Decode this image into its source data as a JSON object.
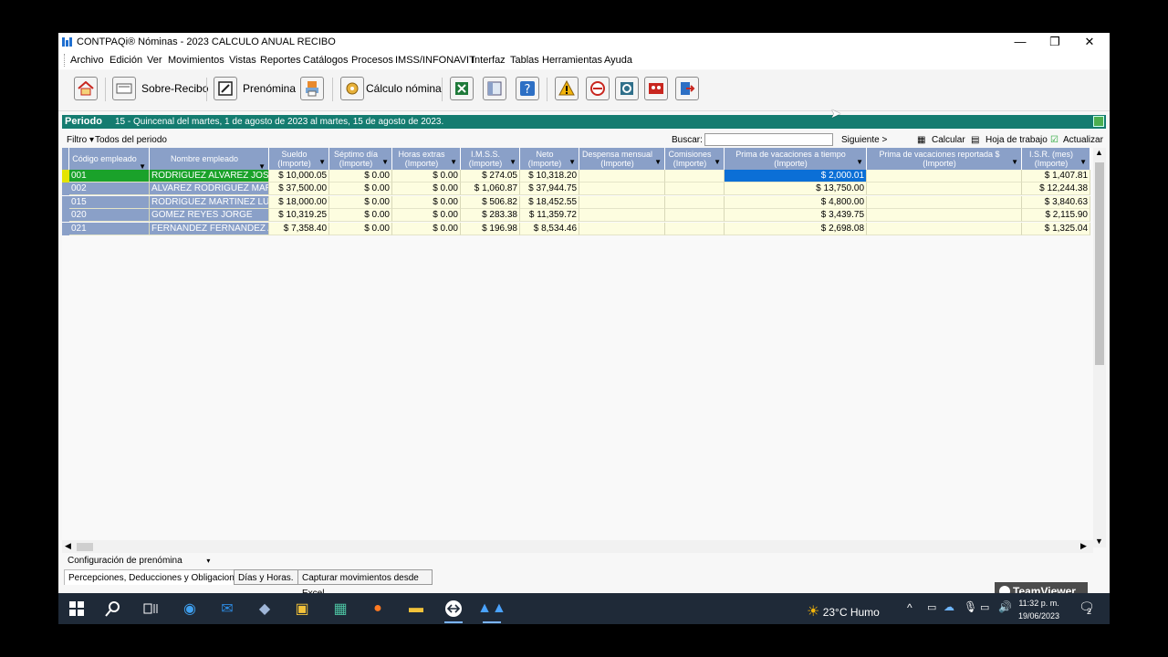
{
  "window": {
    "title": "CONTPAQi® Nóminas - 2023 CALCULO ANUAL RECIBO",
    "controls": [
      "—",
      "❐",
      "✕"
    ]
  },
  "menu": [
    "Archivo",
    "Edición",
    "Ver",
    "Movimientos",
    "Vistas",
    "Reportes",
    "Catálogos",
    "Procesos",
    "IMSS/INFONAVIT",
    "Interfaz",
    "Tablas",
    "Herramientas",
    "Ayuda"
  ],
  "toolbar": {
    "sobre_recibo": "Sobre-Recibo",
    "prenomina": "Prenómina",
    "calculo_nomina": "Cálculo nómina"
  },
  "period": {
    "label": "Periodo",
    "text": "15 - Quincenal del martes, 1 de agosto de 2023 al martes, 15 de agosto de 2023."
  },
  "filter": {
    "label": "Filtro",
    "value": "Todos del periodo",
    "search_label": "Buscar:",
    "next": "Siguiente >",
    "calcular": "Calcular",
    "hoja": "Hoja de trabajo",
    "actualizar": "Actualizar"
  },
  "grid": {
    "headers": [
      {
        "l1": "Código empleado",
        "l2": ""
      },
      {
        "l1": "Nombre empleado",
        "l2": ""
      },
      {
        "l1": "Sueldo",
        "l2": "(Importe)"
      },
      {
        "l1": "Séptimo día",
        "l2": "(Importe)"
      },
      {
        "l1": "Horas extras",
        "l2": "(Importe)"
      },
      {
        "l1": "I.M.S.S.",
        "l2": "(Importe)"
      },
      {
        "l1": "Neto",
        "l2": "(Importe)"
      },
      {
        "l1": "Despensa mensual",
        "l2": "(Importe)"
      },
      {
        "l1": "Comisiones",
        "l2": "(Importe)"
      },
      {
        "l1": "Prima de vacaciones a tiempo",
        "l2": "(Importe)"
      },
      {
        "l1": "Prima de vacaciones reportada $",
        "l2": "(Importe)"
      },
      {
        "l1": "I.S.R. (mes)",
        "l2": "(Importe)"
      }
    ],
    "rows": [
      [
        "001",
        "RODRIGUEZ ALVAREZ JOSE",
        "$ 10,000.05",
        "$ 0.00",
        "$ 0.00",
        "$ 274.05",
        "$ 10,318.20",
        "",
        "",
        "$ 2,000.01",
        "",
        "$ 1,407.81"
      ],
      [
        "002",
        "ALVAREZ RODRIGUEZ MARIA",
        "$ 37,500.00",
        "$ 0.00",
        "$ 0.00",
        "$ 1,060.87",
        "$ 37,944.75",
        "",
        "",
        "$ 13,750.00",
        "",
        "$ 12,244.38"
      ],
      [
        "015",
        "RODRIGUEZ MARTINEZ LUIS",
        "$ 18,000.00",
        "$ 0.00",
        "$ 0.00",
        "$ 506.82",
        "$ 18,452.55",
        "",
        "",
        "$ 4,800.00",
        "",
        "$ 3,840.63"
      ],
      [
        "020",
        "GOMEZ REYES JORGE",
        "$ 10,319.25",
        "$ 0.00",
        "$ 0.00",
        "$ 283.38",
        "$ 11,359.72",
        "",
        "",
        "$ 3,439.75",
        "",
        "$ 2,115.90"
      ],
      [
        "021",
        "FERNANDEZ FERNANDEZ AL",
        "$ 7,358.40",
        "$ 0.00",
        "$ 0.00",
        "$ 196.98",
        "$ 8,534.46",
        "",
        "",
        "$ 2,698.08",
        "",
        "$ 1,325.04"
      ]
    ]
  },
  "bottom": {
    "config_label": "Configuración de prenómina",
    "tabs": [
      "Percepciones, Deducciones y Obligaciones.",
      "Días y Horas.",
      "Capturar movimientos desde Excel"
    ]
  },
  "taskbar": {
    "weather": "23°C  Humo",
    "time": "11:32 p. m.",
    "date": "19/06/2023",
    "notif_count": "2"
  },
  "teamviewer": "TeamViewer",
  "colors": {
    "period_bar": "#147c70",
    "header": "#8aa0c8",
    "selected_row": "#1aa22a",
    "selected_cell": "#0b6fd6",
    "cell_bg": "#fdfde0"
  }
}
